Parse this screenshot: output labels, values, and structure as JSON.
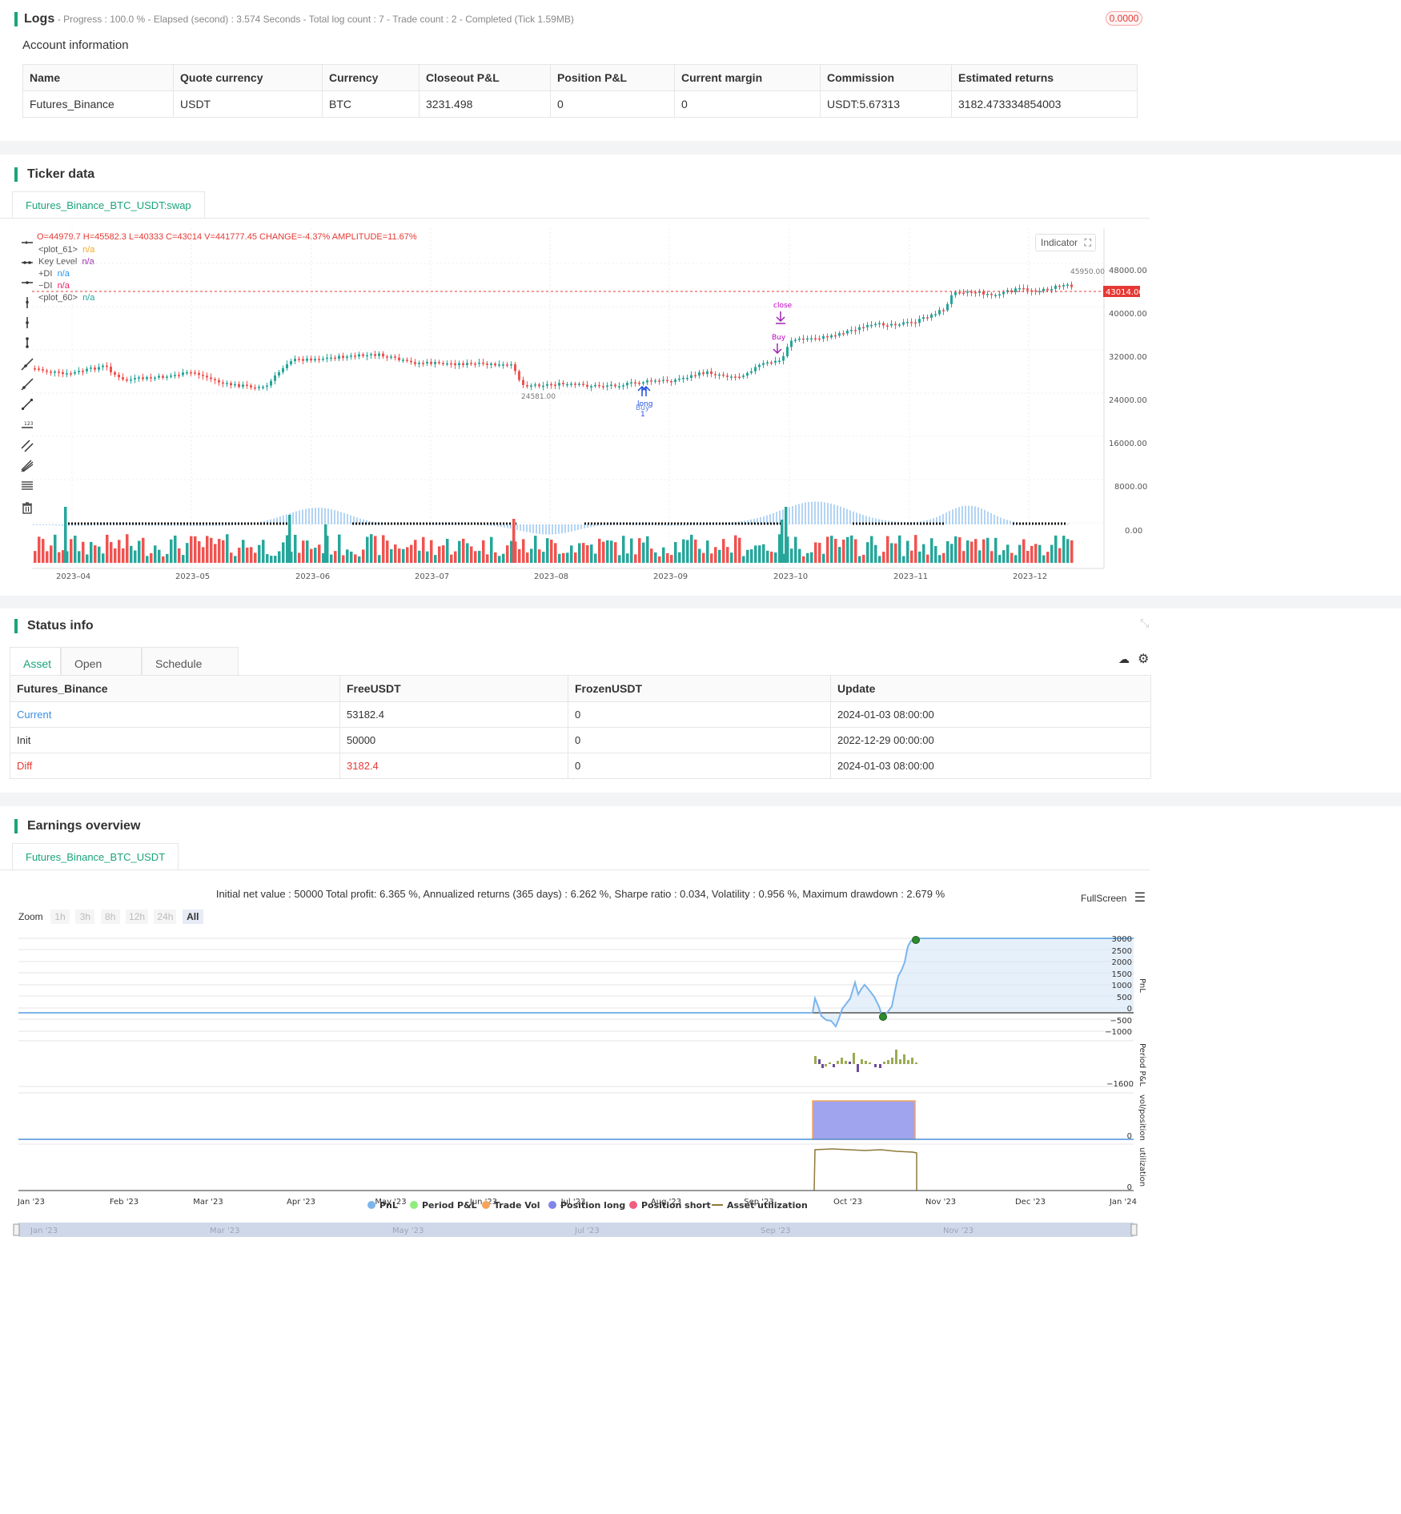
{
  "logs": {
    "title": "Logs",
    "status": "- Progress : 100.0 % - Elapsed (second) : 3.574  Seconds - Total log count : 7 - Trade count : 2 - Completed (Tick 1.59MB)",
    "badge": "0.0000",
    "account_title": "Account information",
    "columns": [
      "Name",
      "Quote currency",
      "Currency",
      "Closeout P&L",
      "Position P&L",
      "Current margin",
      "Commission",
      "Estimated returns"
    ],
    "row": [
      "Futures_Binance",
      "USDT",
      "BTC",
      "3231.498",
      "0",
      "0",
      "USDT:5.67313",
      "3182.473334854003"
    ]
  },
  "ticker": {
    "title": "Ticker data",
    "tab": "Futures_Binance_BTC_USDT:swap",
    "ohlc": "O=44979.7 H=45582.3 L=40333 C=43014 V=441777.45 CHANGE=-4.37% AMPLITUDE=11.67%",
    "legend": [
      {
        "name": "<plot_61>",
        "value": "n/a",
        "color": "#f5a623"
      },
      {
        "name": "Key Level",
        "value": "n/a",
        "color": "#9c27b0"
      },
      {
        "name": "+DI",
        "value": "n/a",
        "color": "#2196f3"
      },
      {
        "name": "−DI",
        "value": "n/a",
        "color": "#e91e63"
      },
      {
        "name": "<plot_60>",
        "value": "n/a",
        "color": "#26a69a"
      }
    ],
    "indicator_btn": "Indicator",
    "price_labels": [
      "48000.00",
      "40000.00",
      "32000.00",
      "24000.00",
      "16000.00",
      "8000.00",
      "0.00"
    ],
    "last_price": "43014.00",
    "high_marker": "45950.00",
    "low_marker": "24581.00",
    "x_labels": [
      "2023–04",
      "2023–05",
      "2023–06",
      "2023–07",
      "2023–08",
      "2023–09",
      "2023–10",
      "2023–11",
      "2023–12"
    ],
    "signals": {
      "close": "close",
      "buy": "Buy",
      "long": "long",
      "buy_count": "1",
      "buy2": "Buy"
    }
  },
  "status": {
    "title": "Status info",
    "tabs": [
      "Asset",
      "Open orders",
      "Schedule orders"
    ],
    "columns": [
      "Futures_Binance",
      "FreeUSDT",
      "FrozenUSDT",
      "Update"
    ],
    "rows": [
      [
        "Current",
        "53182.4",
        "0",
        "2024-01-03 08:00:00"
      ],
      [
        "Init",
        "50000",
        "0",
        "2022-12-29 00:00:00"
      ],
      [
        "Diff",
        "3182.4",
        "0",
        "2024-01-03 08:00:00"
      ]
    ]
  },
  "earnings": {
    "title": "Earnings overview",
    "tab": "Futures_Binance_BTC_USDT",
    "summary": "Initial net value : 50000 Total profit: 6.365 %, Annualized returns (365 days) : 6.262 %, Sharpe ratio : 0.034, Volatility : 0.956 %, Maximum drawdown : 2.679 %",
    "fullscreen": "FullScreen",
    "zoom_label": "Zoom",
    "zoom_buttons": [
      "1h",
      "3h",
      "8h",
      "12h",
      "24h",
      "All"
    ],
    "pnl_ticks": [
      "3000",
      "2500",
      "2000",
      "1500",
      "1000",
      "500",
      "0",
      "−500",
      "−1000"
    ],
    "period_tick": "−1600",
    "zero": "0",
    "axis_titles": [
      "PnL",
      "Period P&L",
      "vol/position",
      "utilization"
    ],
    "x_labels": [
      "Jan '23",
      "Feb '23",
      "Mar '23",
      "Apr '23",
      "May '23",
      "Jun '23",
      "Jul '23",
      "Aug '23",
      "Sep '23",
      "Oct '23",
      "Nov '23",
      "Dec '23",
      "Jan '24"
    ],
    "legend": [
      {
        "name": "PnL",
        "color": "#7cb5ec"
      },
      {
        "name": "Period P&L",
        "color": "#90ed7d"
      },
      {
        "name": "Trade Vol",
        "color": "#f7a35c"
      },
      {
        "name": "Position long",
        "color": "#8085e9"
      },
      {
        "name": "Position short",
        "color": "#f15c80"
      },
      {
        "name": "Asset utilization",
        "color": "#8d7a3a"
      }
    ],
    "navigator_labels": [
      "Jan '23",
      "Mar '23",
      "May '23",
      "Jul '23",
      "Sep '23",
      "Nov '23"
    ]
  }
}
